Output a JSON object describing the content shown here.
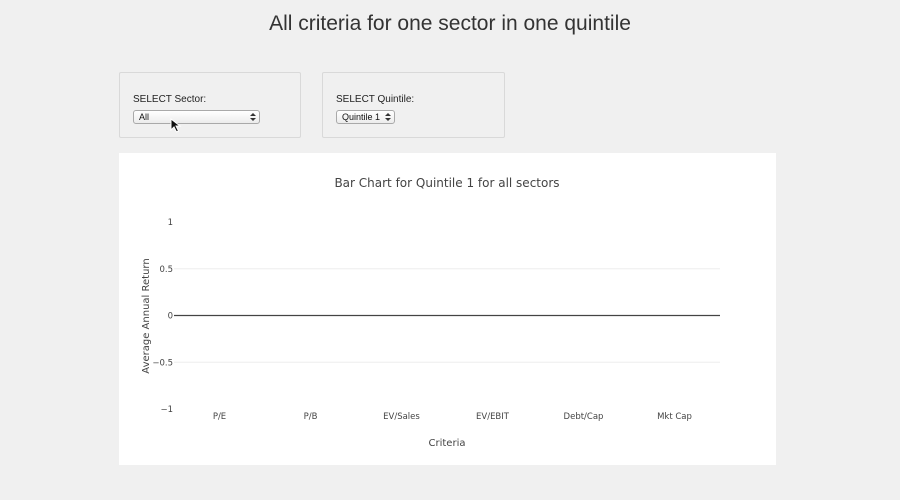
{
  "page": {
    "title": "All criteria for one sector in one quintile"
  },
  "controls": {
    "sector": {
      "label": "SELECT Sector:",
      "selected": "All"
    },
    "quintile": {
      "label": "SELECT Quintile:",
      "selected": "Quintile 1"
    }
  },
  "colors": {
    "page_background": "#f0f0f0",
    "card_background": "#ffffff",
    "gridline": "#eeeeee",
    "zero_line": "#444444",
    "text": "#444444"
  },
  "chart_data": {
    "type": "bar",
    "title": "Bar Chart for Quintile 1 for all sectors",
    "xlabel": "Criteria",
    "ylabel": "Average Annual Return",
    "categories": [
      "P/E",
      "P/B",
      "EV/Sales",
      "EV/EBIT",
      "Debt/Cap",
      "Mkt Cap"
    ],
    "values": [
      0,
      0,
      0,
      0,
      0,
      0
    ],
    "ylim": [
      -1,
      1
    ],
    "yticks": [
      -1,
      -0.5,
      0,
      0.5,
      1
    ],
    "ytick_labels": [
      "−1",
      "−0.5",
      "0",
      "0.5",
      "1"
    ],
    "grid": true,
    "legend": "none"
  }
}
